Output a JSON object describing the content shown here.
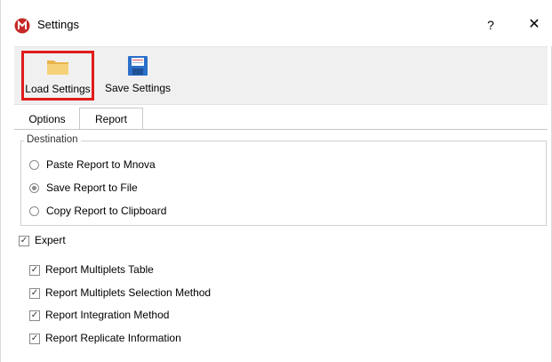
{
  "window": {
    "title": "Settings",
    "help_label": "?",
    "close_label": "✕"
  },
  "toolbar": {
    "load_label": "Load Settings",
    "save_label": "Save Settings"
  },
  "tabs": [
    {
      "label": "Options",
      "active": false
    },
    {
      "label": "Report",
      "active": true
    }
  ],
  "destination": {
    "title": "Destination",
    "options": [
      {
        "label": "Paste Report to Mnova",
        "selected": false
      },
      {
        "label": "Save Report to File",
        "selected": true
      },
      {
        "label": "Copy Report to Clipboard",
        "selected": false
      }
    ]
  },
  "expert": {
    "label": "Expert",
    "checked": true
  },
  "report_options": [
    {
      "label": "Report Multiplets Table",
      "checked": true
    },
    {
      "label": "Report Multiplets Selection Method",
      "checked": true
    },
    {
      "label": "Report Integration Method",
      "checked": true
    },
    {
      "label": "Report Replicate Information",
      "checked": true
    }
  ],
  "colors": {
    "highlight_border": "#e21b1b",
    "app_icon": "#c62828",
    "folder": "#f2c96a",
    "floppy": "#2a6fc9"
  }
}
